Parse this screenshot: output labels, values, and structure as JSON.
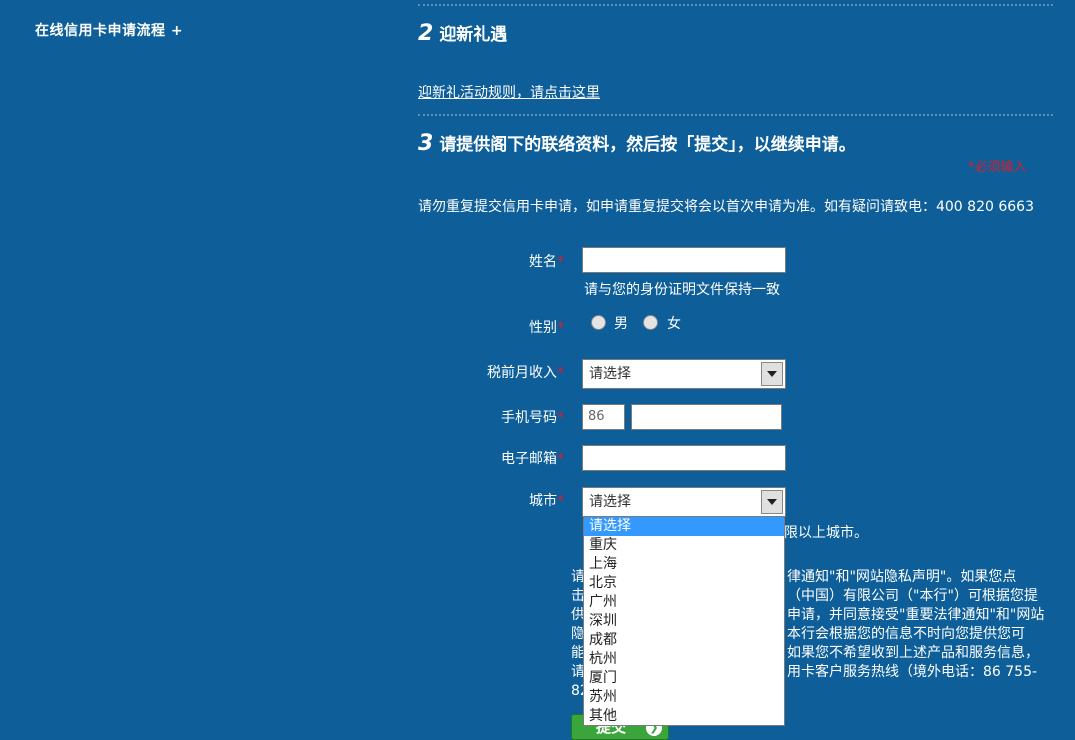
{
  "sidebar": {
    "process_link": "在线信用卡申请流程 +"
  },
  "section2": {
    "number": "2",
    "title": "迎新礼遇",
    "rules_link": "迎新礼活动规则，请点击这里"
  },
  "section3": {
    "number": "3",
    "title": "请提供阁下的联络资料，然后按「提交」，以继续申请。",
    "required_note": "*必须输入",
    "notice": "请勿重复提交信用卡申请，如申请重复提交将会以首次申请为准。如有疑问请致电：400 820 6663"
  },
  "form": {
    "required_mark": "*",
    "name": {
      "label": "姓名",
      "value": "",
      "hint": "请与您的身份证明文件保持一致"
    },
    "gender": {
      "label": "性别",
      "options": [
        "男",
        "女"
      ]
    },
    "income": {
      "label": "税前月收入",
      "selected": "请选择"
    },
    "mobile": {
      "label": "手机号码",
      "country_code": "86",
      "value": ""
    },
    "email": {
      "label": "电子邮箱",
      "value": ""
    },
    "city": {
      "label": "城市",
      "selected": "请选择",
      "options": [
        "请选择",
        "重庆",
        "上海",
        "北京",
        "广州",
        "深圳",
        "成都",
        "杭州",
        "厦门",
        "苏州",
        "其他"
      ],
      "hint_partial": "限以上城市。"
    }
  },
  "consent": {
    "lines": [
      "请",
      "击",
      "供",
      "隐",
      "能",
      "请",
      "82"
    ],
    "right_lines": [
      "律通知\"和\"网站隐私声明\"。如果您点",
      "（中国）有限公司（\"本行\"）可根据您提",
      "申请，并同意接受\"重要法律通知\"和\"网站",
      "本行会根据您的信息不时向您提供您可",
      "如果您不希望收到上述产品和服务信息，",
      "用卡客户服务热线（境外电话：86 755-",
      ""
    ]
  },
  "submit_button": {
    "label": "提交"
  }
}
